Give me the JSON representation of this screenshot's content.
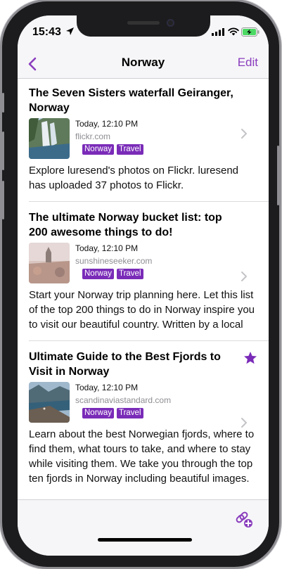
{
  "status": {
    "time": "15:43"
  },
  "nav": {
    "title": "Norway",
    "edit_label": "Edit"
  },
  "items": [
    {
      "title": "The Seven Sisters waterfall Geiranger, Norway",
      "date": "Today, 12:10 PM",
      "domain": "flickr.com",
      "tags": [
        "Norway",
        "Travel"
      ],
      "description": "Explore luresend's photos on Flickr. luresend has uploaded 37 photos to Flickr.",
      "starred": false
    },
    {
      "title": "The ultimate Norway bucket list: top 200 awesome things to do!",
      "date": "Today, 12:10 PM",
      "domain": "sunshineseeker.com",
      "tags": [
        "Norway",
        "Travel"
      ],
      "description": "Start your Norway trip planning here. Let this list of the top 200 things to do in Norway inspire you to visit our beautiful country. Written by a local",
      "starred": false
    },
    {
      "title": "Ultimate Guide to the Best Fjords to Visit in Norway",
      "date": "Today, 12:10 PM",
      "domain": "scandinaviastandard.com",
      "tags": [
        "Norway",
        "Travel"
      ],
      "description": "Learn about the best Norwegian fjords, where to find them, what tours to take, and where to stay while visiting them. We take you through the top ten fjords in Norway including beautiful images.",
      "starred": true
    }
  ],
  "colors": {
    "accent": "#8a3dbd",
    "tag_bg": "#7a2bb8"
  },
  "icons": {
    "back": "chevron-left-icon",
    "chevron": "chevron-right-icon",
    "star": "star-icon",
    "add_link": "add-link-icon"
  }
}
